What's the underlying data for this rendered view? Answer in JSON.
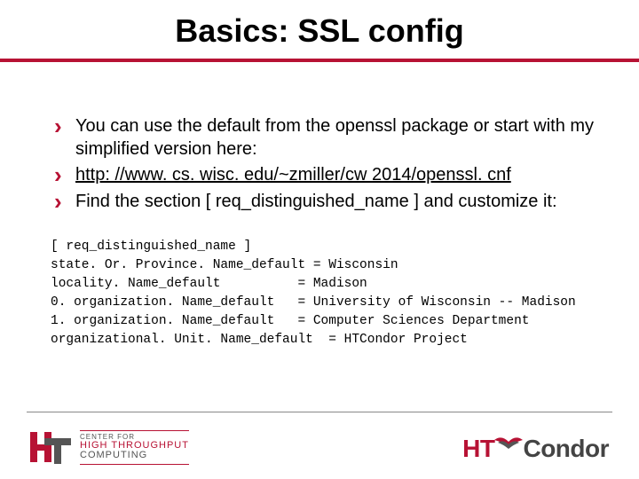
{
  "title": "Basics: SSL config",
  "bullets": [
    "You can use the default from the openssl package or start with my simplified version here:",
    "http: //www. cs. wisc. edu/~zmiller/cw 2014/openssl. cnf",
    "Find the section [ req_distinguished_name ] and customize it:"
  ],
  "code_lines": [
    "[ req_distinguished_name ]",
    "state. Or. Province. Name_default = Wisconsin",
    "locality. Name_default          = Madison",
    "0. organization. Name_default   = University of Wisconsin -- Madison",
    "1. organization. Name_default   = Computer Sciences Department",
    "organizational. Unit. Name_default  = HTCondor Project"
  ],
  "footer": {
    "left": {
      "line1": "CENTER FOR",
      "line2": "HIGH THROUGHPUT",
      "line3": "COMPUTING"
    },
    "right": {
      "ht": "HT",
      "c": "C",
      "rest": "ondor"
    }
  }
}
